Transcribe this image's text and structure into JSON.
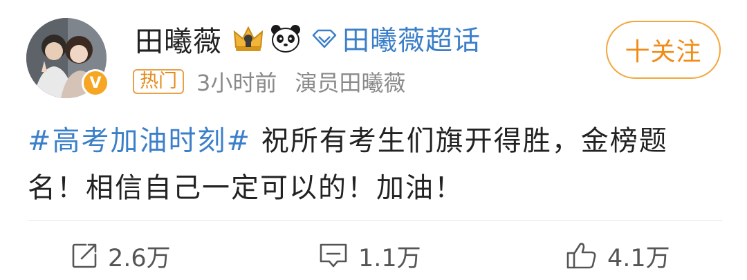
{
  "post": {
    "username": "田曦薇",
    "supertopic_label": "田曦薇超话",
    "follow_label": "十关注",
    "hot_tag": "热门",
    "time": "3小时前",
    "source": "演员田曦薇",
    "hashtag": "#高考加油时刻#",
    "body_text": " 祝所有考生们旗开得胜，金榜题名！相信自己一定可以的！加油！"
  },
  "actions": {
    "share_count": "2.6万",
    "comment_count": "1.1万",
    "like_count": "4.1万"
  },
  "icons": {
    "verified": "v-badge-icon",
    "crown": "crown-icon",
    "panda": "panda-icon",
    "diamond": "diamond-icon",
    "share": "share-icon",
    "comment": "comment-icon",
    "like": "thumbs-up-icon"
  },
  "colors": {
    "link_blue": "#3b7fc9",
    "accent_orange": "#f08c17",
    "text": "#222222",
    "meta_gray": "#8a8a8a"
  }
}
